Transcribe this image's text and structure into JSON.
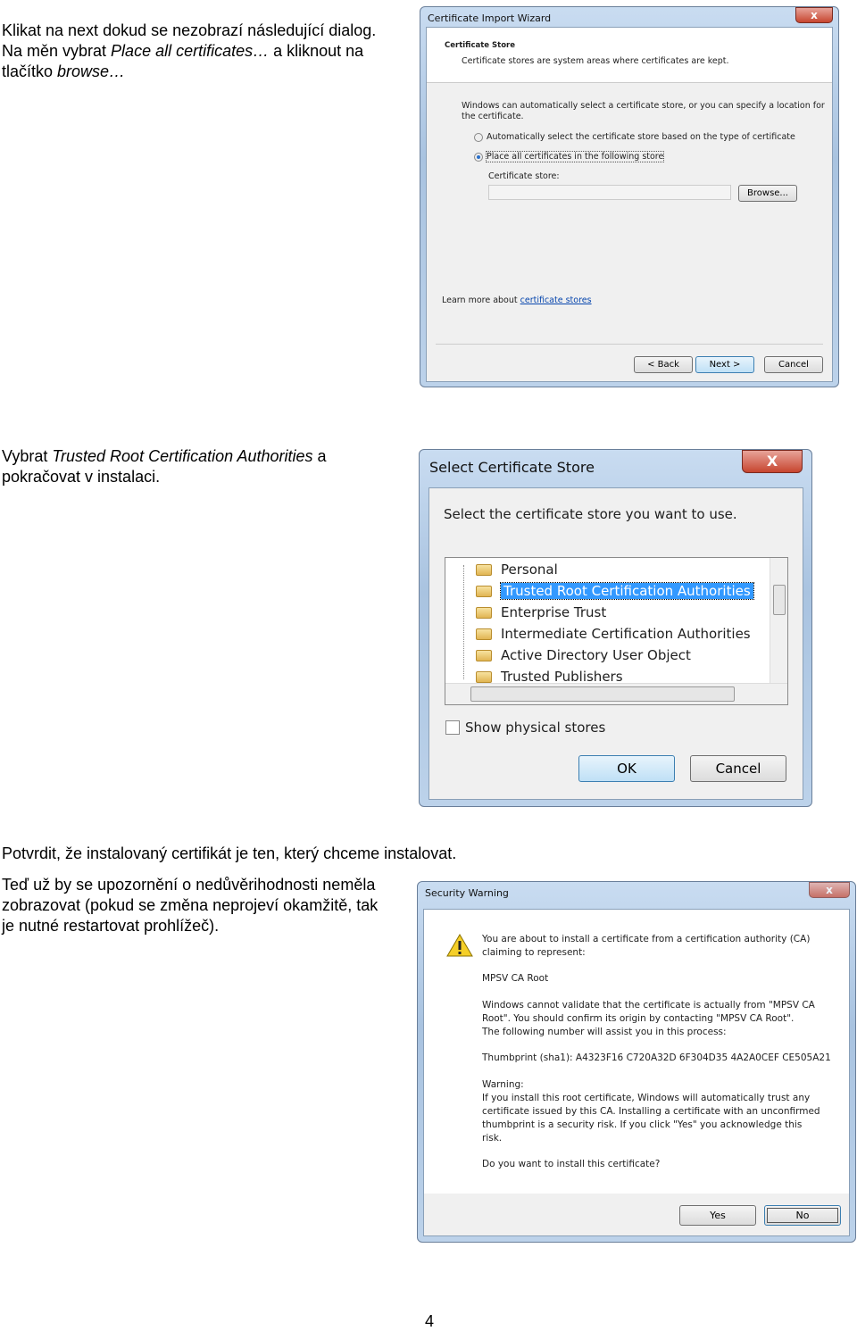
{
  "doc": {
    "para1": {
      "a": "Klikat na next dokud se nezobrazí následující dialog. Na měn vybrat ",
      "b": "Place all certificates…",
      "c": " a kliknout na tlačítko ",
      "d": "browse…"
    },
    "para2": {
      "a": "Vybrat ",
      "b": "Trusted Root Certification Authorities",
      "c": " a pokračovat v instalaci."
    },
    "para3": "Potvrdit, že instalovaný certifikát je ten, který chceme instalovat.",
    "para4": "Teď už by se upozornění o nedůvěrihodnosti neměla zobrazovat (pokud se změna neprojeví okamžitě, tak je nutné restartovat prohlížeč).",
    "page_number": "4"
  },
  "wizard": {
    "title": "Certificate Import Wizard",
    "close": "x",
    "heading": "Certificate Store",
    "subheading": "Certificate stores are system areas where certificates are kept.",
    "desc1": "Windows can automatically select a certificate store, or you can specify a location for",
    "desc2": "the certificate.",
    "radio_auto": "Automatically select the certificate store based on the type of certificate",
    "radio_place": "Place all certificates in the following store",
    "store_label": "Certificate store:",
    "store_value": "",
    "browse": "Browse...",
    "learn_more": "Learn more about ",
    "learn_link": "certificate stores",
    "back": "< Back",
    "next": "Next >",
    "cancel": "Cancel"
  },
  "select_store": {
    "title": "Select Certificate Store",
    "close": "X",
    "prompt": "Select the certificate store you want to use.",
    "items": [
      "Personal",
      "Trusted Root Certification Authorities",
      "Enterprise Trust",
      "Intermediate Certification Authorities",
      "Active Directory User Object",
      "Trusted Publishers"
    ],
    "selected": "Trusted Root Certification Authorities",
    "show_physical": "Show physical stores",
    "show_physical_checked": false,
    "ok": "OK",
    "cancel": "Cancel"
  },
  "security": {
    "title": "Security Warning",
    "close": "x",
    "lines": [
      "You are about to install a certificate from a certification authority (CA)",
      "claiming to represent:"
    ],
    "ca_name": "MPSV CA Root",
    "validate": [
      "Windows cannot validate that the certificate is actually from \"MPSV CA",
      "Root\". You should confirm its origin by contacting \"MPSV CA Root\".",
      "The following number will assist you in this process:"
    ],
    "thumbprint": "Thumbprint (sha1): A4323F16 C720A32D 6F304D35 4A2A0CEF CE505A21",
    "warning_label": "Warning:",
    "warning": [
      "If you install this root certificate, Windows will automatically trust any",
      "certificate issued by this CA. Installing a certificate with an unconfirmed",
      "thumbprint is a security risk. If you click \"Yes\" you acknowledge this",
      "risk."
    ],
    "question": "Do you want to install this certificate?",
    "yes": "Yes",
    "no": "No"
  }
}
